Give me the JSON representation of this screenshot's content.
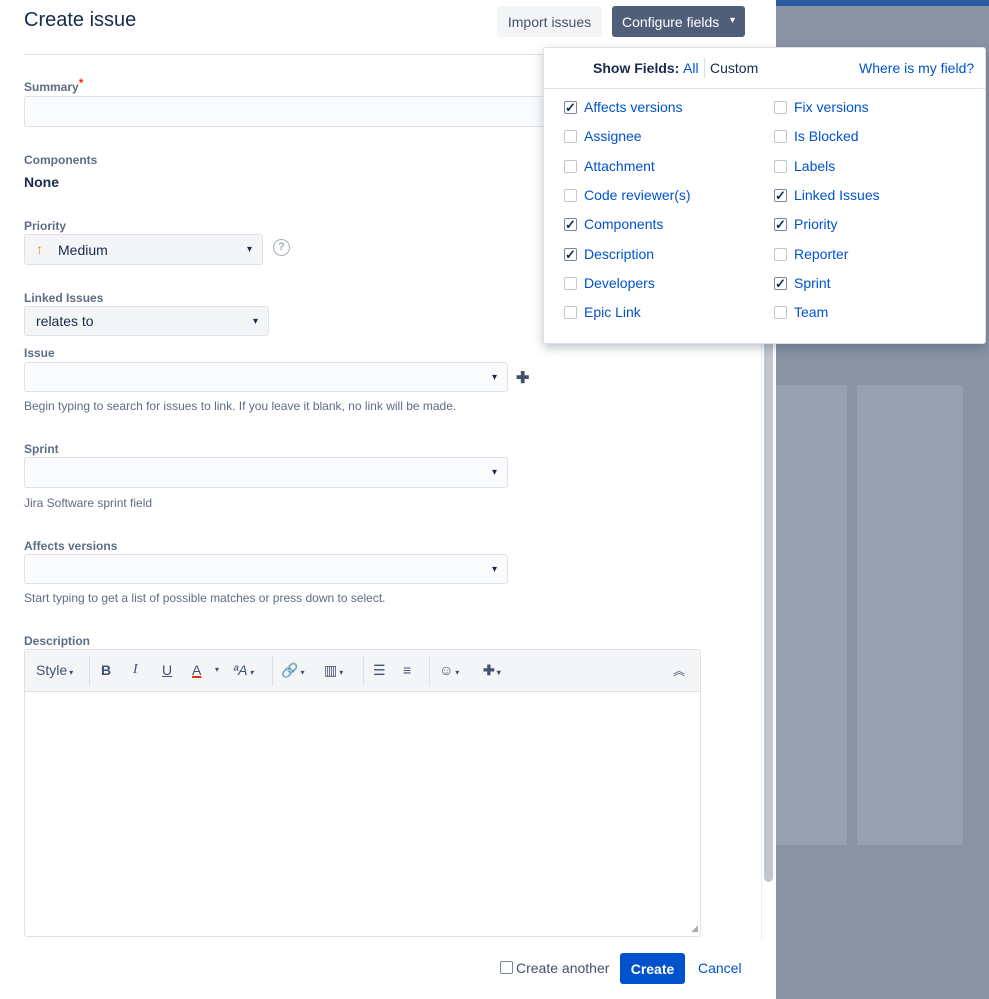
{
  "dialog": {
    "title": "Create issue",
    "import_label": "Import issues",
    "configure_label": "Configure fields",
    "configure_chevron": "▾"
  },
  "form": {
    "summary": {
      "label": "Summary",
      "required_mark": "*",
      "value": ""
    },
    "components": {
      "label": "Components",
      "value": "None"
    },
    "priority": {
      "label": "Priority",
      "value": "Medium",
      "arrow": "↑",
      "help": "?"
    },
    "linked_issues": {
      "label": "Linked Issues",
      "value": "relates to"
    },
    "issue": {
      "label": "Issue",
      "value": "",
      "hint": "Begin typing to search for issues to link. If you leave it blank, no link will be made.",
      "add_icon": "✚"
    },
    "sprint": {
      "label": "Sprint",
      "value": "",
      "hint": "Jira Software sprint field"
    },
    "affects_versions": {
      "label": "Affects versions",
      "value": "",
      "hint": "Start typing to get a list of possible matches or press down to select."
    },
    "description": {
      "label": "Description",
      "value": ""
    }
  },
  "editor_toolbar": {
    "style_label": "Style",
    "bold": "B",
    "italic": "I",
    "underline": "U",
    "text_color": "A",
    "more_format": "ªA",
    "link": "🔗",
    "attachment": "▥",
    "bullet_list": "☰",
    "numbered_list": "≡",
    "emoji": "☺",
    "insert": "✚",
    "collapse": "︽"
  },
  "footer": {
    "create_another_label": "Create another",
    "create_another_checked": false,
    "create_label": "Create",
    "cancel_label": "Cancel"
  },
  "configure_popup": {
    "show_fields_label": "Show Fields:",
    "all_label": "All",
    "custom_label": "Custom",
    "where_link": "Where is my field?",
    "left_fields": [
      {
        "label": "Affects versions",
        "checked": true
      },
      {
        "label": "Assignee",
        "checked": false
      },
      {
        "label": "Attachment",
        "checked": false
      },
      {
        "label": "Code reviewer(s)",
        "checked": false
      },
      {
        "label": "Components",
        "checked": true
      },
      {
        "label": "Description",
        "checked": true
      },
      {
        "label": "Developers",
        "checked": false
      },
      {
        "label": "Epic Link",
        "checked": false
      }
    ],
    "right_fields": [
      {
        "label": "Fix versions",
        "checked": false
      },
      {
        "label": "Is Blocked",
        "checked": false
      },
      {
        "label": "Labels",
        "checked": false
      },
      {
        "label": "Linked Issues",
        "checked": true
      },
      {
        "label": "Priority",
        "checked": true
      },
      {
        "label": "Reporter",
        "checked": false
      },
      {
        "label": "Sprint",
        "checked": true
      },
      {
        "label": "Team",
        "checked": false
      }
    ]
  },
  "colors": {
    "primary": "#0052cc",
    "configure_button": "#505f79",
    "background_app": "#8993a4",
    "required": "#de350b",
    "priority_medium": "#ff8b00"
  }
}
